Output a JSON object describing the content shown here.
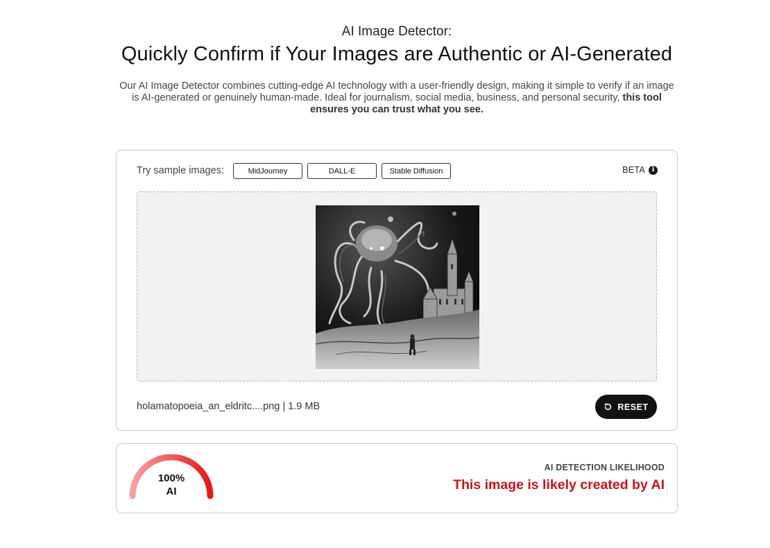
{
  "header": {
    "subtitle": "AI Image Detector:",
    "headline": "Quickly Confirm if Your Images are Authentic or AI-Generated",
    "description": "Our AI Image Detector combines cutting-edge AI technology with a user-friendly design, making it simple to verify if an image is AI-generated or genuinely human-made. Ideal for journalism, social media, business, and personal security, ",
    "description_bold": "this tool ensures you can trust what you see."
  },
  "uploader": {
    "samples_label": "Try sample images:",
    "samples": [
      "MidJourney",
      "DALL-E",
      "Stable Diffusion"
    ],
    "beta_label": "BETA",
    "info_icon": "info-icon",
    "preview_icon": "image-preview",
    "file_info": "holamatopoeia_an_eldritc....png | 1.9 MB",
    "reset_label": "RESET",
    "reset_icon": "reset-icon"
  },
  "result": {
    "gauge_percent": 100,
    "gauge_value_label": "100%",
    "gauge_kind_label": "AI",
    "likelihood_label": "AI DETECTION LIKELIHOOD",
    "verdict": "This image is likely created by AI",
    "colors": {
      "gauge_start": "#f7a2a2",
      "gauge_end": "#e8161c",
      "verdict": "#c4141c"
    }
  }
}
